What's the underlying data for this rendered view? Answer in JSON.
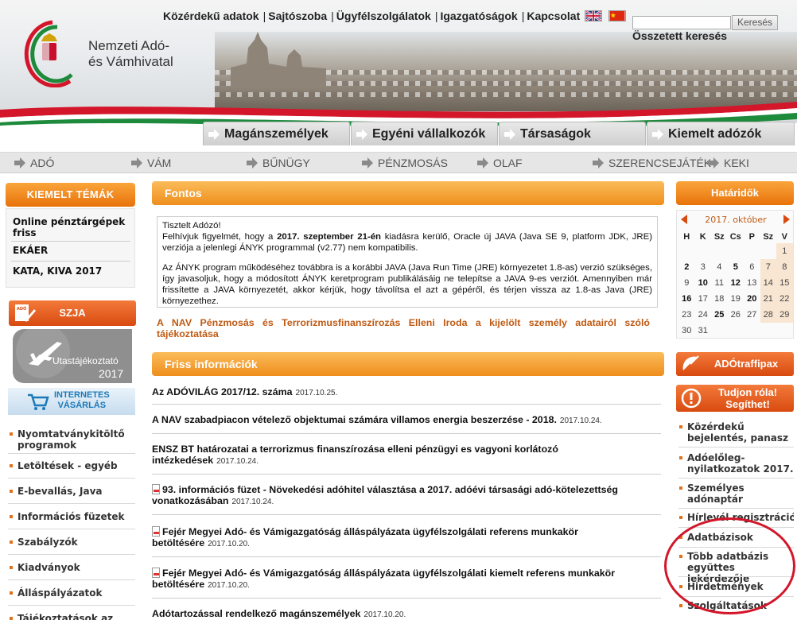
{
  "top_links": [
    "Közérdekű adatok",
    "Sajtószoba",
    "Ügyfélszolgálatok",
    "Igazgatóságok",
    "Kapcsolat"
  ],
  "search": {
    "button": "Keresés",
    "advanced": "Összetett keresés"
  },
  "logo": {
    "line1": "Nemzeti Adó-",
    "line2": "és Vámhivatal"
  },
  "main_tabs": [
    "Magánszemélyek",
    "Egyéni vállalkozók",
    "Társaságok",
    "Kiemelt adózók"
  ],
  "sub_nav": [
    "ADÓ",
    "VÁM",
    "BŰNÜGY",
    "PÉNZMOSÁS",
    "OLAF",
    "SZERENCSEJÁTÉK",
    "KEKI"
  ],
  "left": {
    "kiemelt_title": "KIEMELT TÉMÁK",
    "kiemelt_items": [
      "Online pénztárgépek friss",
      "EKÁER",
      "KATA, KIVA 2017"
    ],
    "szja": "SZJA",
    "utas_line1": "Utastájékoztató",
    "utas_line2": "2017",
    "internet_line1": "INTERNETES",
    "internet_line2": "VÁSÁRLÁS",
    "nav": [
      "Nyomtatványkitöltő programok",
      "Letöltések - egyéb",
      "E-bevallás, Java",
      "Információs füzetek",
      "Szabályzók",
      "Kiadványok",
      "Álláspályázatok",
      "Tájékoztatások az"
    ]
  },
  "center": {
    "fontos_title": "Fontos",
    "notice_p1_a": "Tisztelt Adózó!",
    "notice_p1_b": "Felhívjuk figyelmét, hogy a ",
    "notice_p1_date": "2017. szeptember 21-én",
    "notice_p1_c": " kiadásra kerülő, Oracle új JAVA (Java SE 9, platform JDK, JRE) verziója a jelenlegi ÁNYK programmal (v2.77) nem kompatibilis.",
    "notice_p2": "Az ÁNYK program működéséhez továbbra is a korábbi JAVA (Java Run Time (JRE) környezetet 1.8-as) verzió szükséges, így javasoljuk, hogy a módosított ÁNYK keretprogram publikálásáig ne telepítse a JAVA 9-es verziót. Amennyiben már frissítette a JAVA környezetét, akkor kérjük, hogy távolítsa el azt a gépéről, és térjen vissza az 1.8-as Java (JRE) környezethez.",
    "nav_link": "A NAV Pénzmosás és Terrorizmusfinanszírozás Elleni Iroda a kijelölt személy adatairól szóló tájékoztatása",
    "friss_title": "Friss információk",
    "news": [
      {
        "title": "Az ADÓVILÁG 2017/12. száma",
        "date": "2017.10.25."
      },
      {
        "title": "A NAV szabadpiacon vételező objektumai számára villamos energia beszerzése - 2018.",
        "date": "2017.10.24."
      },
      {
        "title": "ENSZ BT határozatai a terrorizmus finanszírozása elleni pénzügyi es vagyoni korlátozó intézkedések",
        "date": "2017.10.24."
      },
      {
        "title": "93. információs füzet - Növekedési adóhitel választása a 2017. adóévi társasági adó-kötelezettség vonatkozásában",
        "date": "2017.10.24."
      },
      {
        "title": "Fejér Megyei Adó- és Vámigazgatóság álláspályázata ügyfélszolgálati referens munkakör betöltésére",
        "date": "2017.10.20."
      },
      {
        "title": "Fejér Megyei Adó- és Vámigazgatóság álláspályázata ügyfélszolgálati kiemelt referens munkakör betöltésére",
        "date": "2017.10.20."
      },
      {
        "title": "Adótartozással rendelkező magánszemélyek",
        "date": "2017.10.20."
      }
    ]
  },
  "right": {
    "hataridok_title": "Határidők",
    "calendar_month": "2017. október",
    "weekdays": [
      "H",
      "K",
      "Sz",
      "Cs",
      "P",
      "Sz",
      "V"
    ],
    "adotraffipax": "ADÓtraffipax",
    "tudjon_line1": "Tudjon róla!",
    "tudjon_line2": "Segíthet!",
    "nav": [
      "Közérdekű bejelentés, panasz",
      "Adóelőleg-nyilatkozatok 2017.",
      "Személyes adónaptár",
      "Hírlevél regisztráció",
      "Adatbázisok",
      "Több adatbázis együttes lekérdezője",
      "Hirdetmények",
      "Szolgáltatások"
    ]
  },
  "colors": {
    "accent_orange": "#ee8e1c",
    "link_brown": "#c05a13",
    "annotation_red": "#d3162a"
  }
}
